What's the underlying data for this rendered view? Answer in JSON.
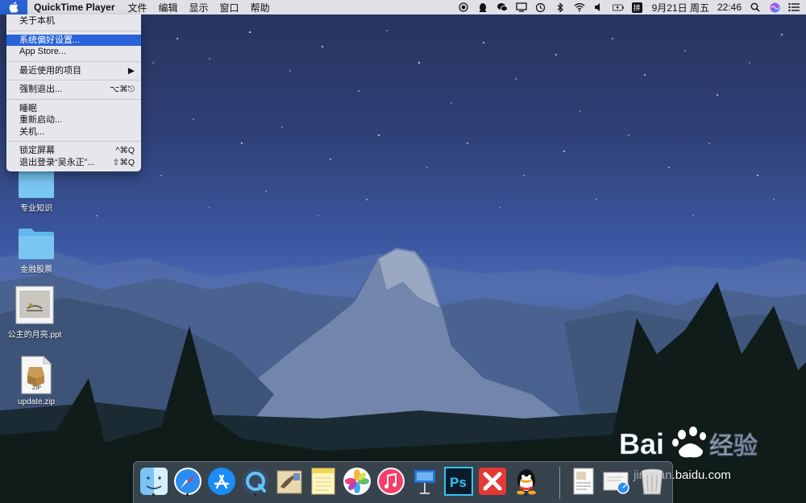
{
  "menubar": {
    "app_name": "QuickTime Player",
    "menus": [
      "文件",
      "编辑",
      "显示",
      "窗口",
      "帮助"
    ],
    "date": "9月21日 周五",
    "time": "22:46",
    "input_method": "拼"
  },
  "apple_menu": {
    "items": [
      {
        "label": "关于本机",
        "shortcut": ""
      },
      {
        "label": "系统偏好设置...",
        "shortcut": "",
        "selected": true
      },
      {
        "label": "App Store...",
        "shortcut": ""
      },
      {
        "label": "最近使用的项目",
        "shortcut": "▶"
      },
      {
        "label": "强制退出...",
        "shortcut": "⌥⌘⎋"
      },
      {
        "label": "睡眠",
        "shortcut": ""
      },
      {
        "label": "重新启动...",
        "shortcut": ""
      },
      {
        "label": "关机...",
        "shortcut": ""
      },
      {
        "label": "锁定屏幕",
        "shortcut": "^⌘Q"
      },
      {
        "label": "退出登录“吴永正”...",
        "shortcut": "⇧⌘Q"
      }
    ]
  },
  "desktop_icons": [
    {
      "label": "专业知识",
      "icon": "folder-icon"
    },
    {
      "label": "金融股票",
      "icon": "folder-icon"
    },
    {
      "label": "公主的月亮.ppt",
      "icon": "ppt-file-icon"
    },
    {
      "label": "update.zip",
      "icon": "zip-file-icon",
      "badge": "ZIP"
    }
  ],
  "dock": {
    "items": [
      "finder-icon",
      "safari-icon",
      "app-store-icon",
      "quicktime-icon",
      "mail-icon",
      "notes-icon",
      "photos-icon",
      "itunes-icon",
      "keynote-icon",
      "photoshop-icon",
      "xmind-icon",
      "qq-icon",
      "document-icon",
      "preview-icon",
      "trash-icon"
    ],
    "photoshop_label": "Ps"
  },
  "watermark": {
    "url": "jingyan.baidu.com"
  },
  "colors": {
    "highlight": "#2a63d8",
    "menubar": "#e8e8ec",
    "folder": "#5fb7ec"
  }
}
